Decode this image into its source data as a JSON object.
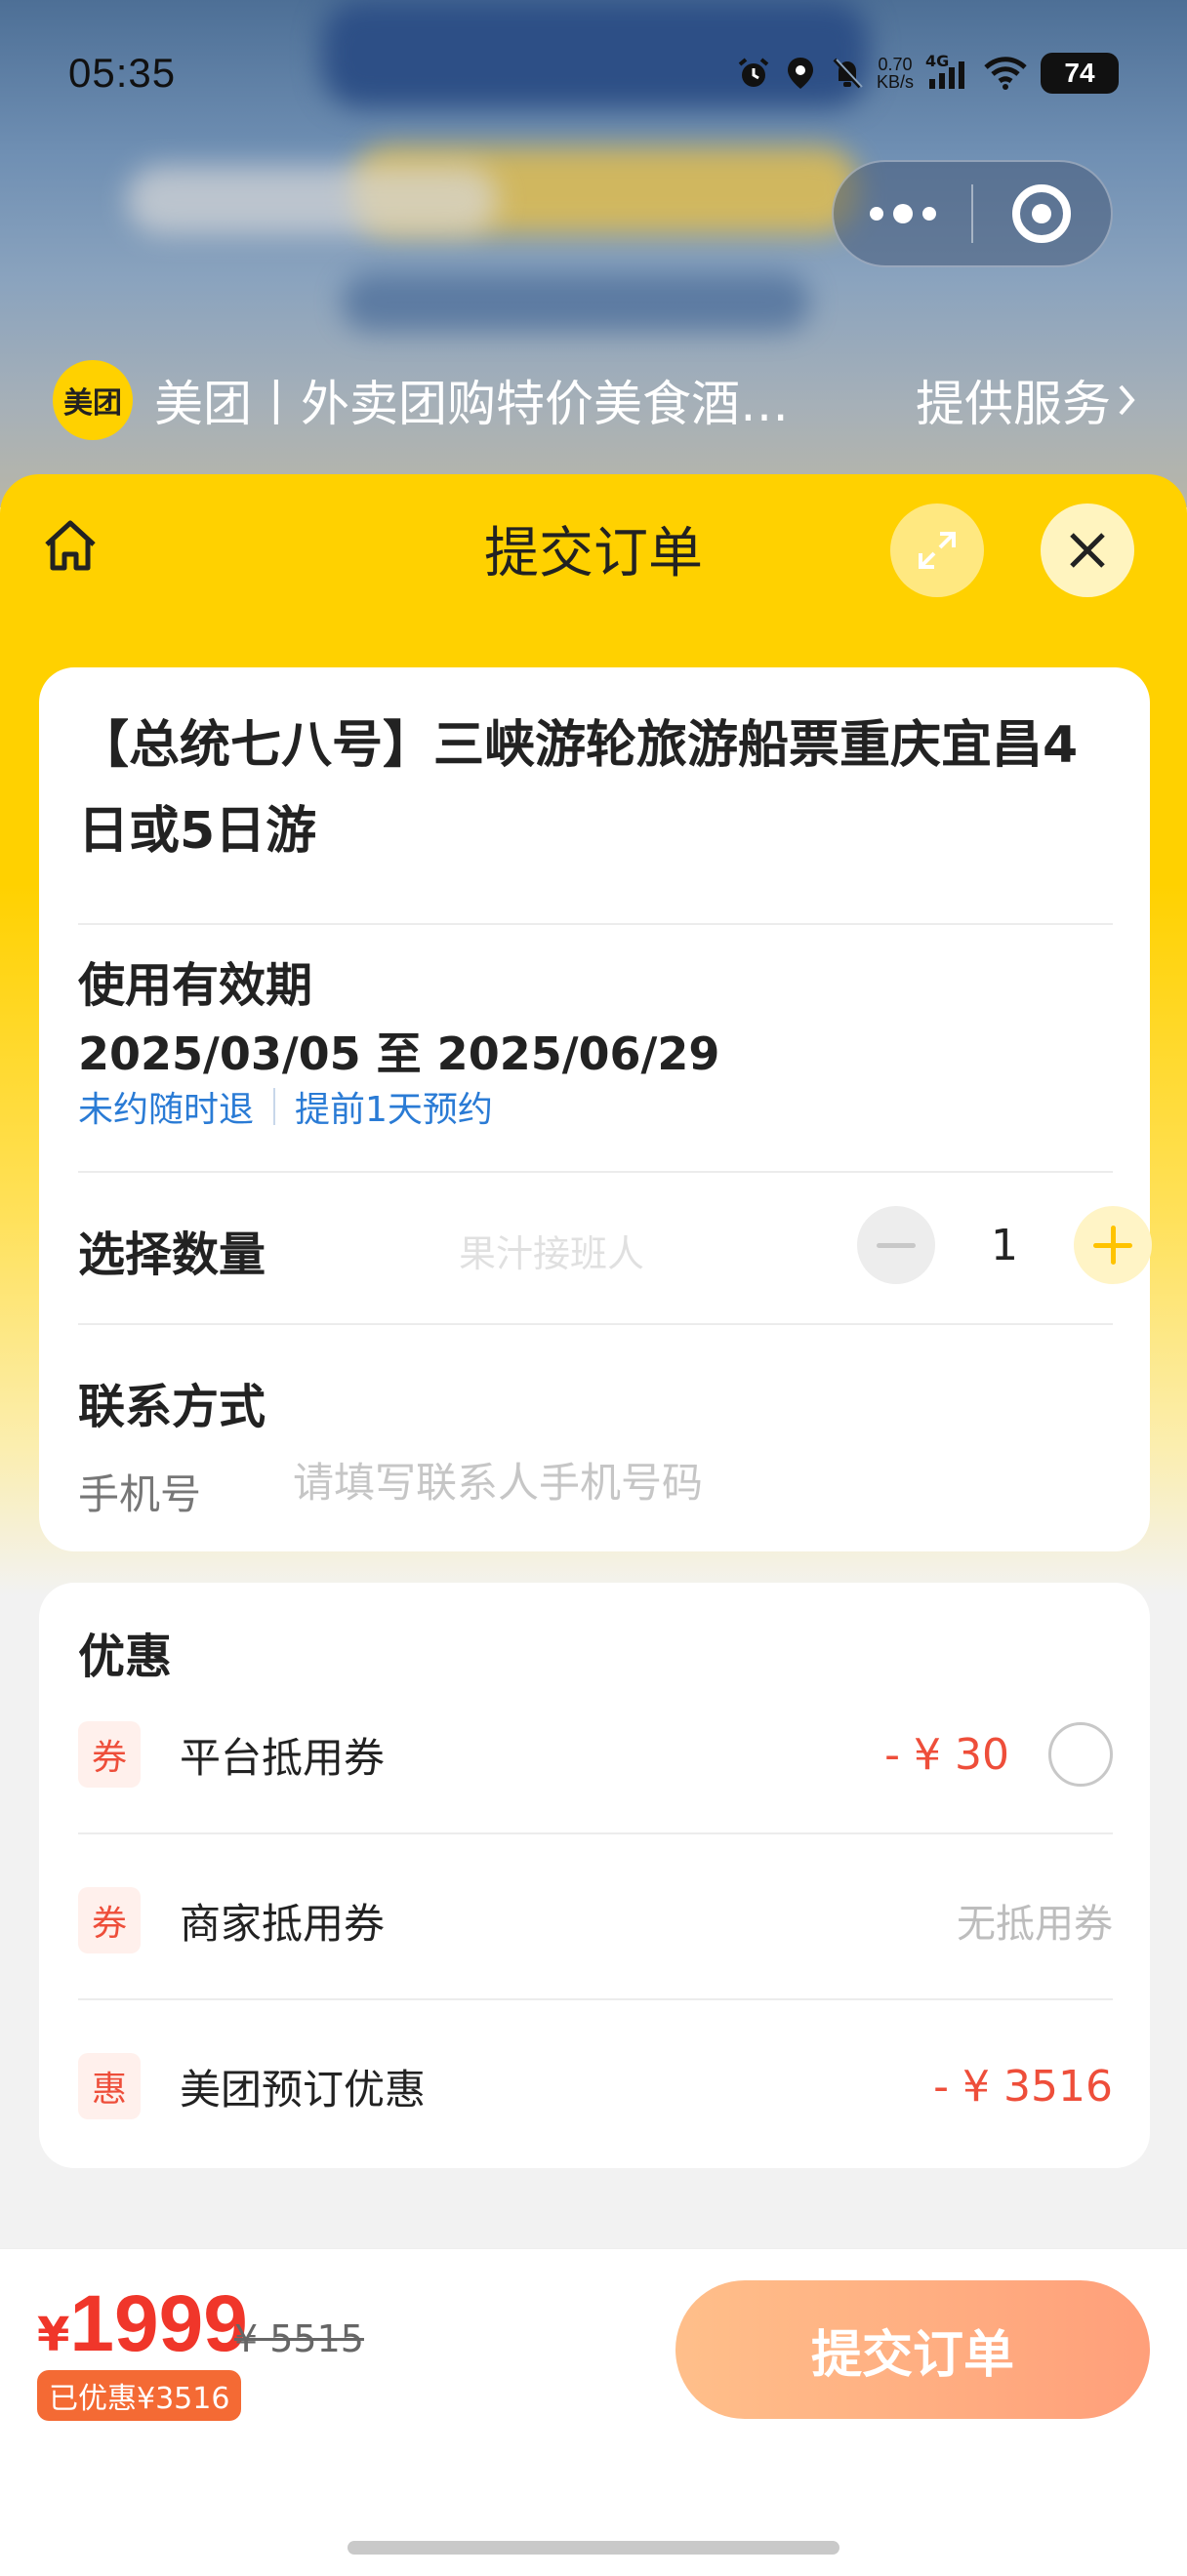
{
  "status_bar": {
    "time": "05:35",
    "net_speed_value": "0.70",
    "net_speed_unit": "KB/s",
    "network": "4G",
    "battery": "74"
  },
  "mini_program": {
    "logo_text": "美团",
    "title": "美团丨外卖团购特价美食酒…",
    "service_link": "提供服务"
  },
  "sheet": {
    "title": "提交订单"
  },
  "product": {
    "title": "【总统七八号】三峡游轮旅游船票重庆宜昌4日或5日游"
  },
  "validity": {
    "label": "使用有效期",
    "range": "2025/03/05 至 2025/06/29",
    "refund_policy": "未约随时退",
    "booking_policy": "提前1天预约"
  },
  "quantity": {
    "label": "选择数量",
    "value": "1",
    "watermark": "果汁接班人"
  },
  "contact": {
    "label": "联系方式",
    "phone_label": "手机号",
    "phone_placeholder": "请填写联系人手机号码",
    "phone_value": ""
  },
  "discounts": {
    "title": "优惠",
    "items": [
      {
        "tag": "券",
        "name": "平台抵用券",
        "value": "- ¥ 30",
        "selectable": true
      },
      {
        "tag": "券",
        "name": "商家抵用券",
        "value": "无抵用券",
        "selectable": false
      },
      {
        "tag": "惠",
        "name": "美团预订优惠",
        "value": "- ¥ 3516",
        "selectable": false
      }
    ]
  },
  "footer": {
    "currency": "¥",
    "price": "1999",
    "original_price": "¥ 5515",
    "saved_badge": "已优惠¥3516",
    "submit_label": "提交订单"
  },
  "colors": {
    "brand_yellow": "#ffd100",
    "accent_red": "#f0362a",
    "link_blue": "#2a7bd5",
    "submit_gradient_start": "#ffbf8a",
    "submit_gradient_end": "#ff9f7a"
  }
}
